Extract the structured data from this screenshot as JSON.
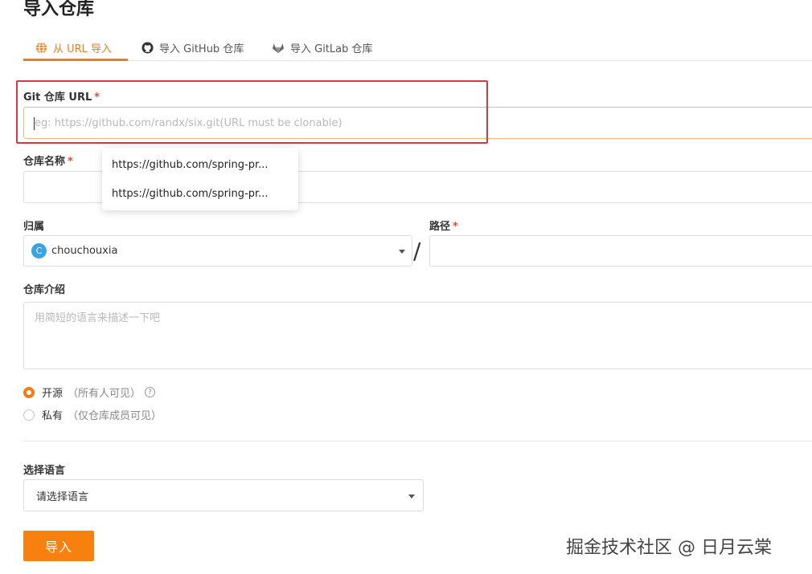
{
  "page": {
    "title": "导入仓库"
  },
  "tabs": [
    {
      "label": "从 URL 导入",
      "icon": "globe-icon",
      "active": true
    },
    {
      "label": "导入 GitHub 仓库",
      "icon": "github-icon",
      "active": false
    },
    {
      "label": "导入 GitLab 仓库",
      "icon": "gitlab-icon",
      "active": false
    }
  ],
  "form": {
    "git_url": {
      "label": "Git 仓库 URL",
      "required_mark": "*",
      "placeholder": "eg: https://github.com/randx/six.git(URL must be clonable)",
      "value": ""
    },
    "suggestions": [
      "https://github.com/spring-pr...",
      "https://github.com/spring-pr..."
    ],
    "repo_name": {
      "label": "仓库名称",
      "required_mark": "*",
      "value": ""
    },
    "owner": {
      "label": "归属",
      "value": "chouchouxia",
      "avatar_letter": "C",
      "avatar_color": "#3aa2e6"
    },
    "path_separator": "/",
    "path": {
      "label": "路径",
      "required_mark": "*",
      "value": ""
    },
    "description": {
      "label": "仓库介绍",
      "placeholder": "用简短的语言来描述一下吧",
      "value": ""
    },
    "visibility": [
      {
        "label": "开源",
        "hint": "（所有人可见）",
        "checked": true,
        "help_icon": "?"
      },
      {
        "label": "私有",
        "hint": "（仅仓库成员可见）",
        "checked": false
      }
    ],
    "language": {
      "label": "选择语言",
      "value": "请选择语言"
    },
    "submit_label": "导入"
  },
  "watermark": "掘金技术社区 @ 日月云棠",
  "colors": {
    "accent": "#f27b16",
    "required": "#e34b3a",
    "highlight_border": "#d9393e"
  }
}
